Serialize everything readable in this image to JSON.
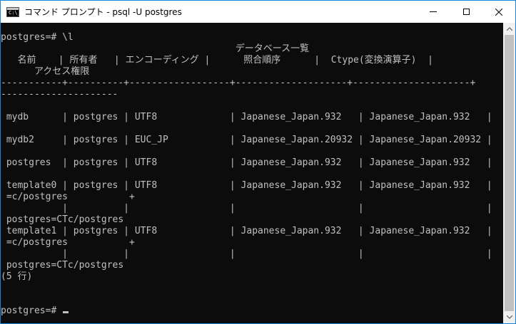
{
  "window": {
    "title": "コマンド プロンプト - psql  -U postgres",
    "icon_glyph": "C:\\_"
  },
  "console": {
    "lines_top": [
      "postgres=# \\l",
      "                                          データベース一覧",
      "   名前    | 所有者   | エンコーディング |      照合順序      |  Ctype(変換演算子)  |",
      "      アクセス権限",
      "-----------+----------+------------------+--------------------+---------------------+",
      "---------------------"
    ],
    "lines_rows": [
      " mydb      | postgres | UTF8             | Japanese_Japan.932   | Japanese_Japan.932   |",
      "",
      " mydb2     | postgres | EUC_JP           | Japanese_Japan.20932 | Japanese_Japan.20932 |",
      "",
      " postgres  | postgres | UTF8             | Japanese_Japan.932   | Japanese_Japan.932   |",
      "",
      " template0 | postgres | UTF8             | Japanese_Japan.932   | Japanese_Japan.932   |",
      " =c/postgres           +",
      "           |          |                  |                      |                      |",
      " postgres=CTc/postgres",
      " template1 | postgres | UTF8             | Japanese_Japan.932   | Japanese_Japan.932   |",
      " =c/postgres           +",
      "           |          |                  |                      |                      |",
      " postgres=CTc/postgres",
      "(5 行)",
      "",
      ""
    ],
    "prompt": "postgres=# "
  }
}
